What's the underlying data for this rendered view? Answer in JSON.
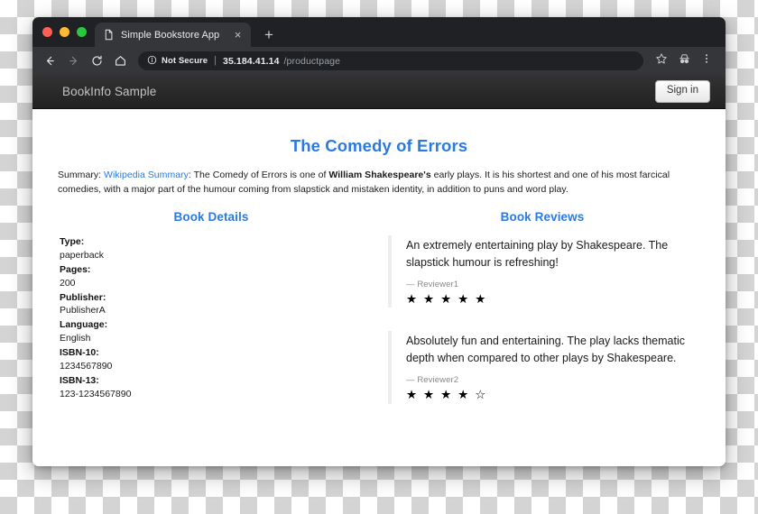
{
  "browser": {
    "window_controls": [
      {
        "name": "close",
        "color": "#ff5f57"
      },
      {
        "name": "minimize",
        "color": "#febc2e"
      },
      {
        "name": "maximize",
        "color": "#28c840"
      }
    ],
    "tab": {
      "title": "Simple Bookstore App",
      "favicon": "page-icon",
      "close_label": "×"
    },
    "new_tab_label": "+",
    "nav": {
      "back": "back-arrow-icon",
      "forward": "forward-arrow-icon",
      "reload": "reload-icon",
      "home": "home-icon"
    },
    "omnibox": {
      "info_icon": "info-circle-icon",
      "security_label": "Not Secure",
      "separator": "|",
      "url_host": "35.184.41.14",
      "url_path": "/productpage"
    },
    "toolbar_icons": {
      "bookmark": "star-icon",
      "incognito": "incognito-icon",
      "menu": "three-dot-menu-icon"
    }
  },
  "app": {
    "navbar": {
      "brand": "BookInfo Sample",
      "signin_label": "Sign in"
    },
    "book_title": "The Comedy of Errors",
    "summary": {
      "prefix": "Summary: ",
      "link_text": "Wikipedia Summary",
      "part1": ": The Comedy of Errors is one of ",
      "bold": "William Shakespeare's",
      "part2": " early plays. It is his shortest and one of his most farcical comedies, with a major part of the humour coming from slapstick and mistaken identity, in addition to puns and word play."
    },
    "details": {
      "heading": "Book Details",
      "rows": [
        {
          "label": "Type:",
          "value": "paperback"
        },
        {
          "label": "Pages:",
          "value": "200"
        },
        {
          "label": "Publisher:",
          "value": "PublisherA"
        },
        {
          "label": "Language:",
          "value": "English"
        },
        {
          "label": "ISBN-10:",
          "value": "1234567890"
        },
        {
          "label": "ISBN-13:",
          "value": "123-1234567890"
        }
      ]
    },
    "reviews": {
      "heading": "Book Reviews",
      "items": [
        {
          "text": "An extremely entertaining play by Shakespeare. The slapstick humour is refreshing!",
          "reviewer": "— Reviewer1",
          "rating": 5,
          "stars": "★ ★ ★ ★ ★"
        },
        {
          "text": "Absolutely fun and entertaining. The play lacks thematic depth when compared to other plays by Shakespeare.",
          "reviewer": "— Reviewer2",
          "rating": 4,
          "stars": "★ ★ ★ ★ ☆"
        }
      ]
    }
  },
  "colors": {
    "accent_blue": "#2a7ae2",
    "navbar_dark": "#292929",
    "chrome_dark": "#35363a",
    "tabstrip_dark": "#202124"
  }
}
